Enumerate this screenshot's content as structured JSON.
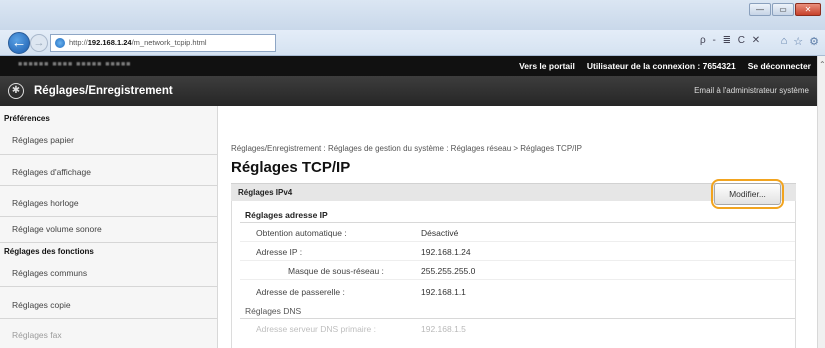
{
  "browser": {
    "url_prefix": "http://",
    "url_host": "192.168.1.24",
    "url_path": "/m_network_tcpip.html",
    "search_tools": "ρ - ≣ C ✕",
    "window_controls": [
      "—",
      "▭",
      "✕"
    ]
  },
  "page_header": {
    "portal_link": "Vers le portail",
    "user_label": "Utilisateur de la connexion :",
    "user_id": "7654321",
    "logout_link": "Se déconnecter"
  },
  "app_bar": {
    "title": "Réglages/Enregistrement",
    "admin_mail": "Email à l'administrateur système"
  },
  "sidebar": {
    "sections": [
      {
        "heading": "Préférences",
        "items": [
          "Réglages papier",
          "Réglages d'affichage",
          "Réglages horloge",
          "Réglage volume sonore"
        ]
      },
      {
        "heading": "Réglages des fonctions",
        "items": [
          "Réglages communs",
          "Réglages copie",
          "Réglages fax"
        ]
      }
    ]
  },
  "main": {
    "breadcrumb": "Réglages/Enregistrement : Réglages de gestion du système : Réglages réseau > Réglages TCP/IP",
    "title": "Réglages TCP/IP",
    "section_title": "Réglages IPv4",
    "modify_button": "Modifier...",
    "ip_settings": {
      "heading": "Réglages adresse IP",
      "rows": [
        {
          "label": "Obtention automatique :",
          "value": "Désactivé"
        },
        {
          "label": "Adresse IP :",
          "value": "192.168.1.24"
        },
        {
          "label": "Masque de sous-réseau :",
          "value": "255.255.255.0"
        },
        {
          "label": "Adresse de passerelle :",
          "value": "192.168.1.1"
        }
      ]
    },
    "dns_settings": {
      "heading": "Réglages DNS",
      "rows": [
        {
          "label": "Adresse serveur DNS primaire :",
          "value": "192.168.1.5"
        }
      ]
    }
  }
}
